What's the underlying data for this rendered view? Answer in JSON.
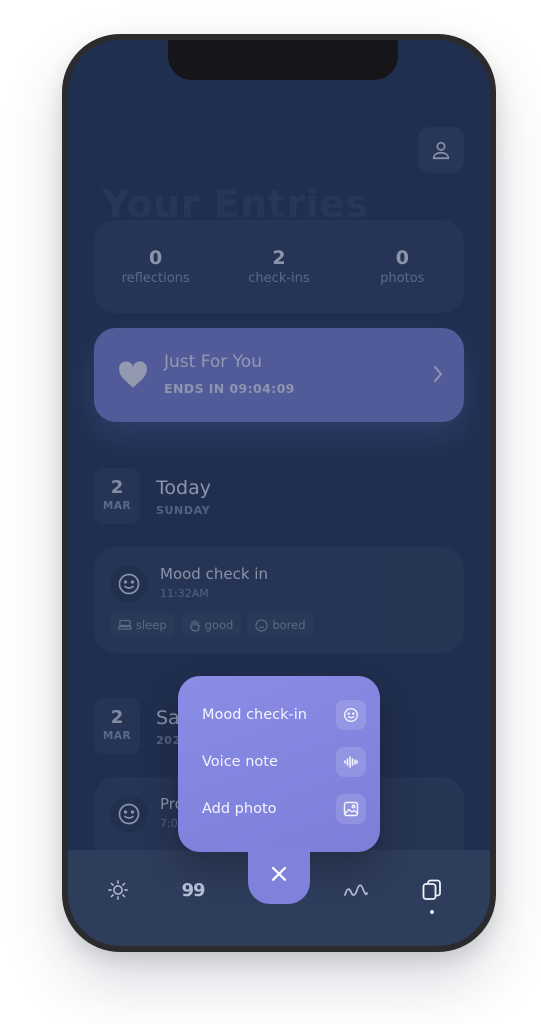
{
  "screen": {
    "title": "Your Entries",
    "stats": [
      {
        "value": "0",
        "label": "reflections"
      },
      {
        "value": "2",
        "label": "check-ins"
      },
      {
        "value": "0",
        "label": "photos"
      }
    ],
    "promo": {
      "title": "Just For You",
      "subtitle": "ENDS IN 09:04:09"
    },
    "days": [
      {
        "day": "2",
        "month": "MAR",
        "title": "Today",
        "subtitle": "SUNDAY",
        "entry": {
          "title": "Mood check in",
          "time": "11:32AM",
          "tags": [
            "sleep",
            "good",
            "bored"
          ]
        }
      },
      {
        "day": "2",
        "month": "MAR",
        "title": "Sa",
        "subtitle": "202",
        "entry": {
          "title": "Pro",
          "time": "7:0"
        }
      }
    ]
  },
  "menu": {
    "items": [
      {
        "label": "Mood check-in",
        "icon": "smile-icon"
      },
      {
        "label": "Voice note",
        "icon": "waveform-icon"
      },
      {
        "label": "Add photo",
        "icon": "image-icon"
      }
    ],
    "close_symbol": "×"
  },
  "tabbar": {
    "tabs": [
      "sun-icon",
      "quote-icon",
      "add-icon",
      "chart-icon",
      "entries-icon"
    ],
    "quote_glyph": "99"
  },
  "colors": {
    "background": "#202f4f",
    "card": "#2c3a5a",
    "accent": "#7a7fd6",
    "tabbar": "#2e3d5c"
  }
}
